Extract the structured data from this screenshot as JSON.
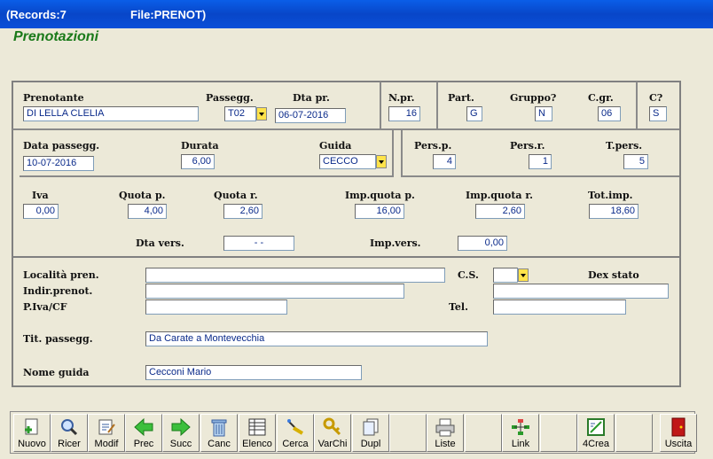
{
  "window": {
    "records": "(Records:7",
    "file": "File:PRENOT)"
  },
  "app_title": "Prenotazioni",
  "labels": {
    "prenotante": "Prenotante",
    "passegg": "Passegg.",
    "dta_pr": "Dta pr.",
    "npr": "N.pr.",
    "part": "Part.",
    "gruppo": "Gruppo?",
    "cgr": "C.gr.",
    "c": "C?",
    "data_passegg": "Data passegg.",
    "durata": "Durata",
    "guida": "Guida",
    "pers_p": "Pers.p.",
    "pers_r": "Pers.r.",
    "t_pers": "T.pers.",
    "iva": "Iva",
    "quota_p": "Quota p.",
    "quota_r": "Quota r.",
    "imp_quota_p": "Imp.quota p.",
    "imp_quota_r": "Imp.quota r.",
    "tot_imp": "Tot.imp.",
    "dta_vers": "Dta vers.",
    "imp_vers": "Imp.vers.",
    "localita": "Località pren.",
    "cs": "C.S.",
    "dex_stato": "Dex stato",
    "indir": "Indir.prenot.",
    "piva": "P.Iva/CF",
    "tel": "Tel.",
    "tit_passegg": "Tit. passegg.",
    "nome_guida": "Nome guida"
  },
  "values": {
    "prenotante": "DI LELLA CLELIA",
    "passegg": "T02",
    "dta_pr": "06-07-2016",
    "npr": "16",
    "part": "G",
    "gruppo": "N",
    "cgr": "06",
    "c": "S",
    "data_passegg": "10-07-2016",
    "durata": "6,00",
    "guida": "CECCO",
    "pers_p": "4",
    "pers_r": "1",
    "t_pers": "5",
    "iva": "0,00",
    "quota_p": "4,00",
    "quota_r": "2,60",
    "imp_quota_p": "16,00",
    "imp_quota_r": "2,60",
    "tot_imp": "18,60",
    "dta_vers": "  -   -",
    "imp_vers": "0,00",
    "localita": "",
    "cs": "",
    "dex_stato": "",
    "indir": "",
    "piva": "",
    "tel": "",
    "tit_passegg": "Da Carate a Montevecchia",
    "nome_guida": "Cecconi Mario"
  },
  "toolbar": [
    {
      "label": "Nuovo",
      "icon": "new-doc-icon"
    },
    {
      "label": "Ricer",
      "icon": "search-icon"
    },
    {
      "label": "Modif",
      "icon": "edit-icon"
    },
    {
      "label": "Prec",
      "icon": "arrow-left-icon"
    },
    {
      "label": "Succ",
      "icon": "arrow-right-icon"
    },
    {
      "label": "Canc",
      "icon": "trash-icon"
    },
    {
      "label": "Elenco",
      "icon": "list-icon"
    },
    {
      "label": "Cerca",
      "icon": "find-icon"
    },
    {
      "label": "VarChi",
      "icon": "keys-icon"
    },
    {
      "label": "Dupl",
      "icon": "duplicate-icon"
    },
    {
      "label": "",
      "icon": ""
    },
    {
      "label": "Liste",
      "icon": "printer-icon"
    },
    {
      "label": "",
      "icon": ""
    },
    {
      "label": "Link",
      "icon": "link-icon"
    },
    {
      "label": "",
      "icon": ""
    },
    {
      "label": "4Crea",
      "icon": "create-icon"
    },
    {
      "label": "",
      "icon": ""
    },
    {
      "label": "Uscita",
      "icon": "exit-icon"
    }
  ]
}
